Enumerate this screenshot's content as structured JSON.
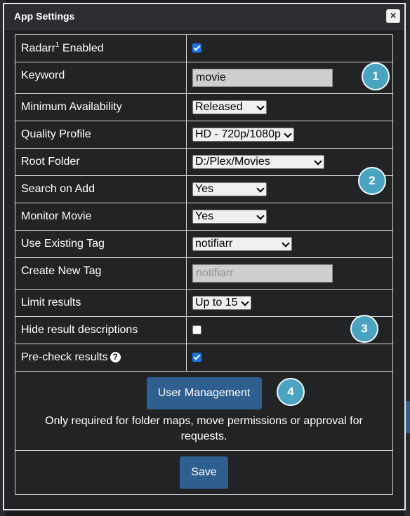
{
  "dialog": {
    "title": "App Settings",
    "close_label": "×"
  },
  "settings": {
    "radarr_enabled": {
      "label": "Radarr",
      "sup": "1",
      "label_suffix": " Enabled",
      "checked": true
    },
    "keyword": {
      "label": "Keyword",
      "value": "movie"
    },
    "minimum_availability": {
      "label": "Minimum Availability",
      "value": "Released"
    },
    "quality_profile": {
      "label": "Quality Profile",
      "value": "HD - 720p/1080p"
    },
    "root_folder": {
      "label": "Root Folder",
      "value": "D:/Plex/Movies"
    },
    "search_on_add": {
      "label": "Search on Add",
      "value": "Yes"
    },
    "monitor_movie": {
      "label": "Monitor Movie",
      "value": "Yes"
    },
    "use_existing_tag": {
      "label": "Use Existing Tag",
      "value": "notifiarr"
    },
    "create_new_tag": {
      "label": "Create New Tag",
      "placeholder": "notifiarr"
    },
    "limit_results": {
      "label": "Limit results",
      "value": "Up to 15"
    },
    "hide_descriptions": {
      "label": "Hide result descriptions",
      "checked": false
    },
    "precheck_results": {
      "label": "Pre-check results",
      "help_icon": "question-circle-icon",
      "checked": true
    }
  },
  "user_management": {
    "button_label": "User Management",
    "note": "Only required for folder maps, move permissions or approval for requests."
  },
  "save_label": "Save",
  "markers": [
    "1",
    "2",
    "3",
    "4"
  ],
  "colors": {
    "button": "#2f5f8f",
    "marker": "#4aa4bf",
    "checkbox": "#1a73e8"
  }
}
